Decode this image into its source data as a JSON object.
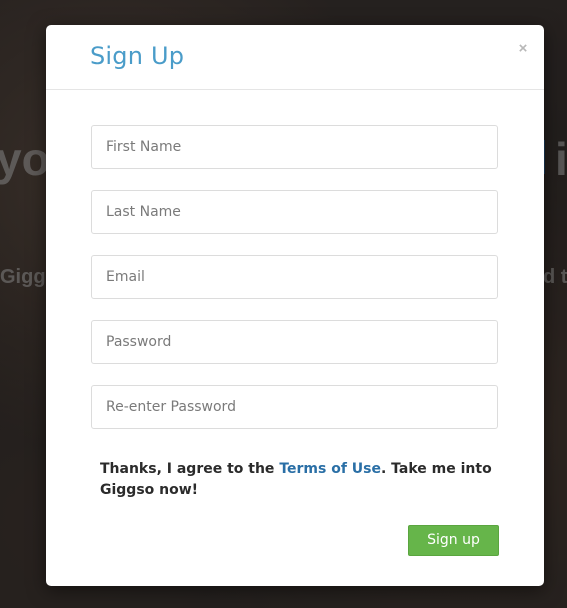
{
  "background": {
    "headline_left": "you",
    "headline_right": "i",
    "sub_left": "Gigg",
    "sub_right": "d t"
  },
  "modal": {
    "title": "Sign Up",
    "close_label": "×",
    "fields": {
      "first_name": {
        "placeholder": "First Name",
        "value": ""
      },
      "last_name": {
        "placeholder": "Last Name",
        "value": ""
      },
      "email": {
        "placeholder": "Email",
        "value": ""
      },
      "password": {
        "placeholder": "Password",
        "value": ""
      },
      "reenter_password": {
        "placeholder": "Re-enter Password",
        "value": ""
      }
    },
    "agreement": {
      "prefix": "Thanks, I agree to the ",
      "link_text": "Terms of Use",
      "suffix": ". Take me into Giggso now!"
    },
    "signup_button_label": "Sign up"
  },
  "colors": {
    "title": "#4a9cc9",
    "link": "#2a6fa6",
    "button": "#66b54a"
  }
}
